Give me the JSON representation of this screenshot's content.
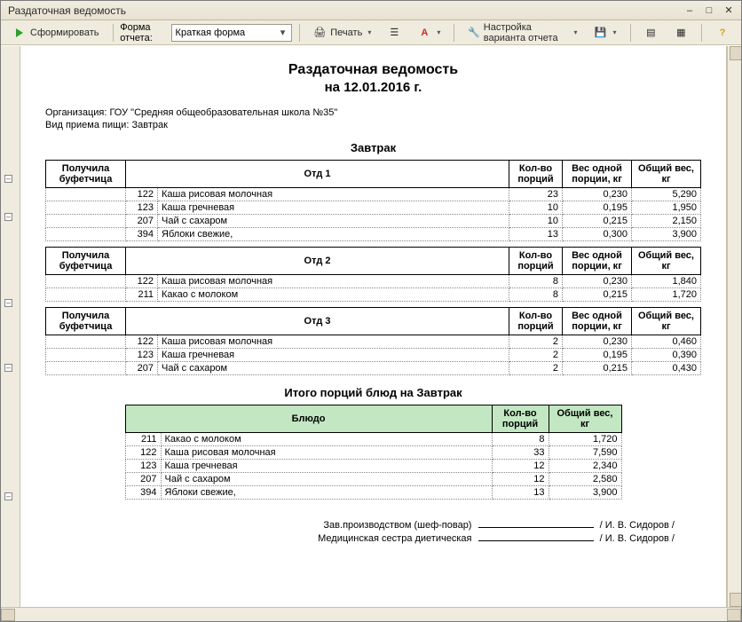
{
  "window": {
    "title": "Раздаточная ведомость"
  },
  "toolbar": {
    "generate": "Сформировать",
    "form_label": "Форма отчета:",
    "form_value": "Краткая форма",
    "print": "Печать",
    "settings": "Настройка варианта отчета"
  },
  "report": {
    "title": "Раздаточная ведомость",
    "subtitle": "на 12.01.2016 г.",
    "org_label": "Организация:",
    "org_value": "ГОУ \"Средняя общеобразовательная школа №35\"",
    "meal_label": "Вид приема пищи:",
    "meal_value": "Завтрак",
    "section_title": "Завтрак",
    "totals_title": "Итого порций блюд на Завтрак",
    "sign1_label": "Зав.производством (шеф-повар)",
    "sign1_name": "/ И. В. Сидоров /",
    "sign2_label": "Медицинская сестра диетическая",
    "sign2_name": "/ И. В. Сидоров /"
  },
  "headers": {
    "received": "Получила буфетчица",
    "dept1": "Отд 1",
    "dept2": "Отд 2",
    "dept3": "Отд 3",
    "portions": "Кол-во порций",
    "weight_one": "Вес одной порции, кг",
    "weight_total": "Общий вес, кг",
    "dish": "Блюдо"
  },
  "dept1": [
    {
      "code": "122",
      "name": "Каша рисовая молочная",
      "qty": "23",
      "wone": "0,230",
      "wtot": "5,290"
    },
    {
      "code": "123",
      "name": "Каша гречневая",
      "qty": "10",
      "wone": "0,195",
      "wtot": "1,950"
    },
    {
      "code": "207",
      "name": "Чай с сахаром",
      "qty": "10",
      "wone": "0,215",
      "wtot": "2,150"
    },
    {
      "code": "394",
      "name": "Яблоки свежие,",
      "qty": "13",
      "wone": "0,300",
      "wtot": "3,900"
    }
  ],
  "dept2": [
    {
      "code": "122",
      "name": "Каша рисовая молочная",
      "qty": "8",
      "wone": "0,230",
      "wtot": "1,840"
    },
    {
      "code": "211",
      "name": "Какао с молоком",
      "qty": "8",
      "wone": "0,215",
      "wtot": "1,720"
    }
  ],
  "dept3": [
    {
      "code": "122",
      "name": "Каша рисовая молочная",
      "qty": "2",
      "wone": "0,230",
      "wtot": "0,460"
    },
    {
      "code": "123",
      "name": "Каша гречневая",
      "qty": "2",
      "wone": "0,195",
      "wtot": "0,390"
    },
    {
      "code": "207",
      "name": "Чай с сахаром",
      "qty": "2",
      "wone": "0,215",
      "wtot": "0,430"
    }
  ],
  "totals": [
    {
      "code": "211",
      "name": "Какао с молоком",
      "qty": "8",
      "wtot": "1,720"
    },
    {
      "code": "122",
      "name": "Каша рисовая молочная",
      "qty": "33",
      "wtot": "7,590"
    },
    {
      "code": "123",
      "name": "Каша гречневая",
      "qty": "12",
      "wtot": "2,340"
    },
    {
      "code": "207",
      "name": "Чай с сахаром",
      "qty": "12",
      "wtot": "2,580"
    },
    {
      "code": "394",
      "name": "Яблоки свежие,",
      "qty": "13",
      "wtot": "3,900"
    }
  ]
}
